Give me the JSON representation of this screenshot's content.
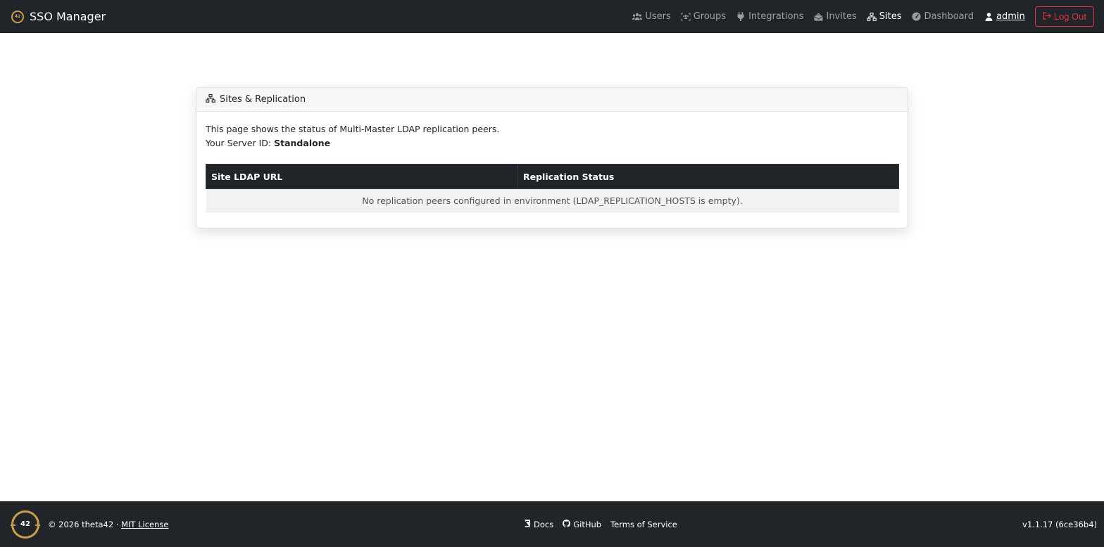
{
  "navbar": {
    "brand": "SSO Manager",
    "links": [
      {
        "label": "Users",
        "icon": "users-icon"
      },
      {
        "label": "Groups",
        "icon": "groups-icon"
      },
      {
        "label": "Integrations",
        "icon": "plug-icon"
      },
      {
        "label": "Invites",
        "icon": "envelope-open-icon"
      },
      {
        "label": "Sites",
        "icon": "network-icon",
        "active": true
      },
      {
        "label": "Dashboard",
        "icon": "gauge-icon"
      }
    ],
    "user": "admin",
    "logout": "Log Out"
  },
  "card": {
    "title": "Sites & Replication",
    "desc_line1": "This page shows the status of Multi-Master LDAP replication peers.",
    "server_id_label": "Your Server ID: ",
    "server_id_value": "Standalone",
    "table": {
      "headers": [
        "Site LDAP URL",
        "Replication Status"
      ],
      "empty_message": "No replication peers configured in environment (LDAP_REPLICATION_HOSTS is empty)."
    }
  },
  "footer": {
    "logo_text": "42",
    "copyright": "© 2026 theta42 ·",
    "license": "MIT License",
    "docs": "Docs",
    "github": "GitHub",
    "tos": "Terms of Service",
    "version": "v1.1.17 (6ce36b4)"
  },
  "colors": {
    "navbar_bg": "#212529",
    "danger": "#dc3545",
    "logo_gold": "#c9a04a"
  }
}
